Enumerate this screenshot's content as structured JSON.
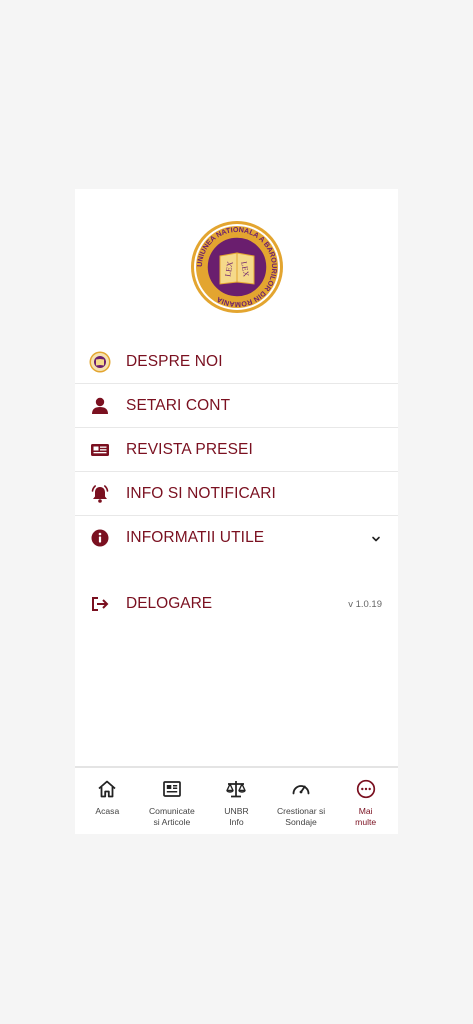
{
  "logo": {
    "ring_text": "UNIUNEA NATIONALA A BAROURILOR DIN ROMANIA",
    "book_text": "LEX",
    "colors": {
      "gold": "#e3a530",
      "purple": "#6a1e6e"
    }
  },
  "menu": {
    "items": [
      {
        "label": "DESPRE NOI",
        "icon": "unbr-logo-icon"
      },
      {
        "label": "SETARI CONT",
        "icon": "user-icon"
      },
      {
        "label": "REVISTA PRESEI",
        "icon": "newspaper-icon"
      },
      {
        "label": "INFO SI NOTIFICARI",
        "icon": "bell-alarm-icon"
      },
      {
        "label": "INFORMATII UTILE",
        "icon": "info-circle-icon",
        "expandable": true
      }
    ],
    "logout": {
      "label": "DELOGARE",
      "icon": "logout-icon"
    },
    "version": "v 1.0.19"
  },
  "tabbar": {
    "tabs": [
      {
        "label": "Acasa",
        "icon": "home-icon"
      },
      {
        "label": "Comunicate\nsi Articole",
        "icon": "news-icon"
      },
      {
        "label": "UNBR\nInfo",
        "icon": "scales-icon"
      },
      {
        "label": "Crestionar si\nSondaje",
        "icon": "gauge-icon"
      },
      {
        "label": "Mai\nmulte",
        "icon": "more-icon",
        "active": true
      }
    ]
  },
  "colors": {
    "accent": "#7a1020",
    "background": "#f5f5f5"
  }
}
